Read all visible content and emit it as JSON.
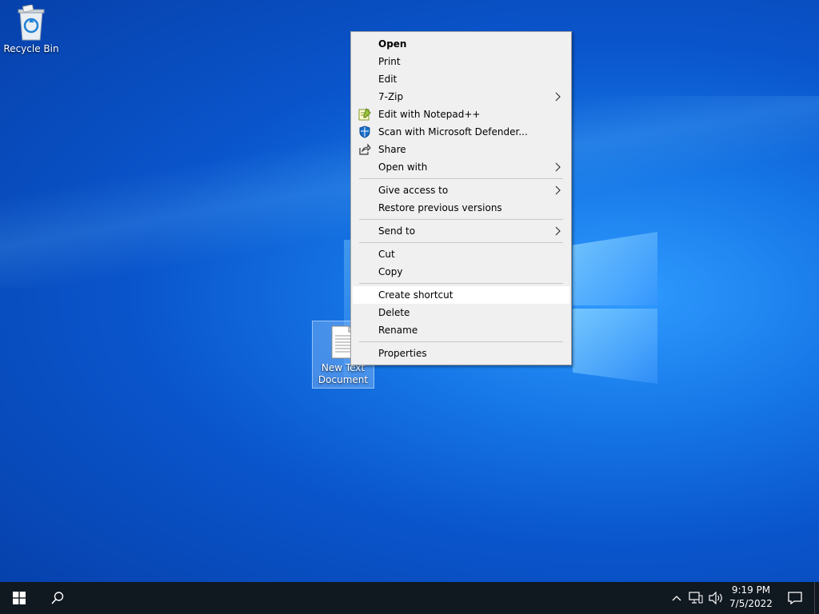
{
  "desktop": {
    "icons": [
      {
        "label": "Recycle Bin",
        "icon": "recycle-bin-icon"
      },
      {
        "label_line1": "New Text",
        "label_line2": "Document",
        "icon": "text-document-icon"
      }
    ]
  },
  "context_menu": {
    "items": [
      {
        "label": "Open",
        "bold": true
      },
      {
        "label": "Print"
      },
      {
        "label": "Edit"
      },
      {
        "label": "7-Zip",
        "submenu": true
      },
      {
        "label": "Edit with Notepad++",
        "icon": "notepad-plus-plus-icon"
      },
      {
        "label": "Scan with Microsoft Defender...",
        "icon": "defender-shield-icon"
      },
      {
        "label": "Share",
        "icon": "share-icon"
      },
      {
        "label": "Open with",
        "submenu": true
      },
      {
        "label": "Give access to",
        "submenu": true
      },
      {
        "label": "Restore previous versions"
      },
      {
        "label": "Send to",
        "submenu": true
      },
      {
        "label": "Cut"
      },
      {
        "label": "Copy"
      },
      {
        "label": "Create shortcut",
        "highlighted": true
      },
      {
        "label": "Delete"
      },
      {
        "label": "Rename"
      },
      {
        "label": "Properties"
      }
    ],
    "submenu_glyph": ">"
  },
  "taskbar": {
    "start_icon": "windows-logo-icon",
    "search_icon": "search-icon",
    "tray": {
      "chevron_glyph": "^",
      "network_icon": "network-icon",
      "volume_icon": "volume-icon",
      "notification_icon": "action-center-icon"
    },
    "clock": {
      "time": "9:19 PM",
      "date": "7/5/2022"
    }
  },
  "colors": {
    "taskbar": "#101820",
    "menu_bg": "#f0f0f0",
    "menu_highlight": "#ffffff",
    "desktop_accent": "#1677e6"
  }
}
